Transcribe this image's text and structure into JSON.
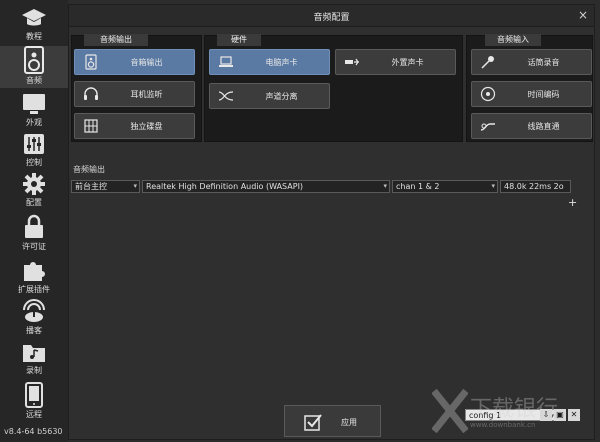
{
  "sidebar": {
    "items": [
      {
        "label": "教程",
        "icon": "graduation-cap-icon"
      },
      {
        "label": "音频",
        "icon": "speaker-icon"
      },
      {
        "label": "外观",
        "icon": "monitor-icon"
      },
      {
        "label": "控制",
        "icon": "sliders-icon"
      },
      {
        "label": "配置",
        "icon": "gear-icon"
      },
      {
        "label": "许可证",
        "icon": "lock-icon"
      },
      {
        "label": "扩展插件",
        "icon": "puzzle-icon"
      },
      {
        "label": "播客",
        "icon": "podcast-icon"
      },
      {
        "label": "录制",
        "icon": "folder-music-icon"
      },
      {
        "label": "远程",
        "icon": "tablet-icon"
      }
    ],
    "active": "音频",
    "version": "v8.4-64 b5630"
  },
  "window": {
    "title": "音频配置",
    "close": "×"
  },
  "panels": {
    "output": {
      "title": "音频输出",
      "buttons": [
        {
          "label": "音箱输出",
          "icon": "speaker-icon",
          "selected": true
        },
        {
          "label": "耳机监听",
          "icon": "headphones-icon",
          "selected": false
        },
        {
          "label": "独立碟盘",
          "icon": "keypad-icon",
          "selected": false
        }
      ]
    },
    "hardware": {
      "title": "硬件",
      "buttons": [
        {
          "label": "电脑声卡",
          "icon": "laptop-icon",
          "selected": true
        },
        {
          "label": "外置声卡",
          "icon": "usb-icon",
          "selected": false
        },
        {
          "label": "声道分离",
          "icon": "cable-split-icon",
          "selected": false
        }
      ]
    },
    "input": {
      "title": "音频输入",
      "buttons": [
        {
          "label": "话筒录音",
          "icon": "microphone-icon",
          "selected": false
        },
        {
          "label": "时间编码",
          "icon": "vinyl-icon",
          "selected": false
        },
        {
          "label": "线路直通",
          "icon": "cable-icon",
          "selected": false
        }
      ]
    }
  },
  "audio_output": {
    "label": "音频输出",
    "channel_select": "前台主控",
    "device_select": "Realtek High Definition Audio (WASAPI)",
    "chan_select": "chan 1 & 2",
    "latency": "48.0k 22ms 2o",
    "add": "+"
  },
  "footer": {
    "apply": "应用",
    "config_select": "config 1",
    "mini_buttons": [
      "⇩",
      "▣",
      "✕"
    ],
    "watermark_title": "下载银行",
    "watermark_url": "www.downbank.cn"
  },
  "colors": {
    "selected": "#5b7aa3",
    "panel": "#1b1b1b",
    "button": "#3c3c3c"
  }
}
